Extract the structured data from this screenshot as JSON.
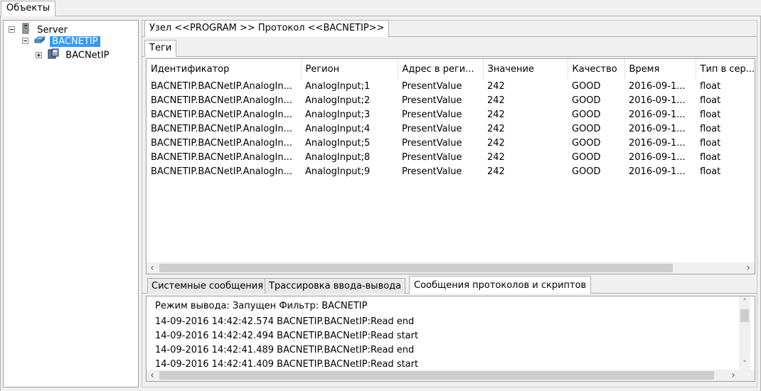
{
  "top_tab": {
    "label": "Объекты"
  },
  "tree": {
    "root": {
      "label": "Server"
    },
    "node1": {
      "label": "BACNETIP"
    },
    "node2": {
      "label": "BACNetIP"
    }
  },
  "breadcrumb_tab": {
    "label": "Узел <<PROGRAM  >> Протокол <<BACNETIP>>"
  },
  "tags_tab": {
    "label": "Теги"
  },
  "table": {
    "columns": [
      "Идентификатор",
      "Регион",
      "Адрес в реги...",
      "Значение",
      "Качество",
      "Время",
      "Тип в сер..."
    ],
    "rows": [
      [
        "BACNETIP.BACNetIP.AnalogIn...",
        "AnalogInput;1",
        "PresentValue",
        "242",
        "GOOD",
        "2016-09-1...",
        "float"
      ],
      [
        "BACNETIP.BACNetIP.AnalogIn...",
        "AnalogInput;2",
        "PresentValue",
        "242",
        "GOOD",
        "2016-09-1...",
        "float"
      ],
      [
        "BACNETIP.BACNetIP.AnalogIn...",
        "AnalogInput;3",
        "PresentValue",
        "242",
        "GOOD",
        "2016-09-1...",
        "float"
      ],
      [
        "BACNETIP.BACNetIP.AnalogIn...",
        "AnalogInput;4",
        "PresentValue",
        "242",
        "GOOD",
        "2016-09-1...",
        "float"
      ],
      [
        "BACNETIP.BACNetIP.AnalogIn...",
        "AnalogInput;5",
        "PresentValue",
        "242",
        "GOOD",
        "2016-09-1...",
        "float"
      ],
      [
        "BACNETIP.BACNetIP.AnalogIn...",
        "AnalogInput;8",
        "PresentValue",
        "242",
        "GOOD",
        "2016-09-1...",
        "float"
      ],
      [
        "BACNETIP.BACNetIP.AnalogIn...",
        "AnalogInput;9",
        "PresentValue",
        "242",
        "GOOD",
        "2016-09-1...",
        "float"
      ]
    ]
  },
  "bottom_tabs": [
    {
      "label": "Системные сообщения"
    },
    {
      "label": "Трассировка ввода-вывода"
    },
    {
      "label": "Сообщения протоколов и скриптов"
    }
  ],
  "log": {
    "header": "Режим вывода: Запущен Фильтр: BACNETIP",
    "lines": [
      "14-09-2016 14:42:42.574 BACNETIP.BACNetIP:Read end",
      "14-09-2016 14:42:42.494 BACNETIP.BACNetIP:Read start",
      "14-09-2016 14:42:41.489 BACNETIP.BACNetIP:Read end",
      "14-09-2016 14:42:41.409 BACNETIP.BACNetIP:Read start"
    ]
  },
  "icons": {
    "scroll_left": "‹",
    "scroll_right": "›",
    "scroll_up": "˄",
    "scroll_down": "˅"
  },
  "colors": {
    "selection": "#3399ff"
  }
}
